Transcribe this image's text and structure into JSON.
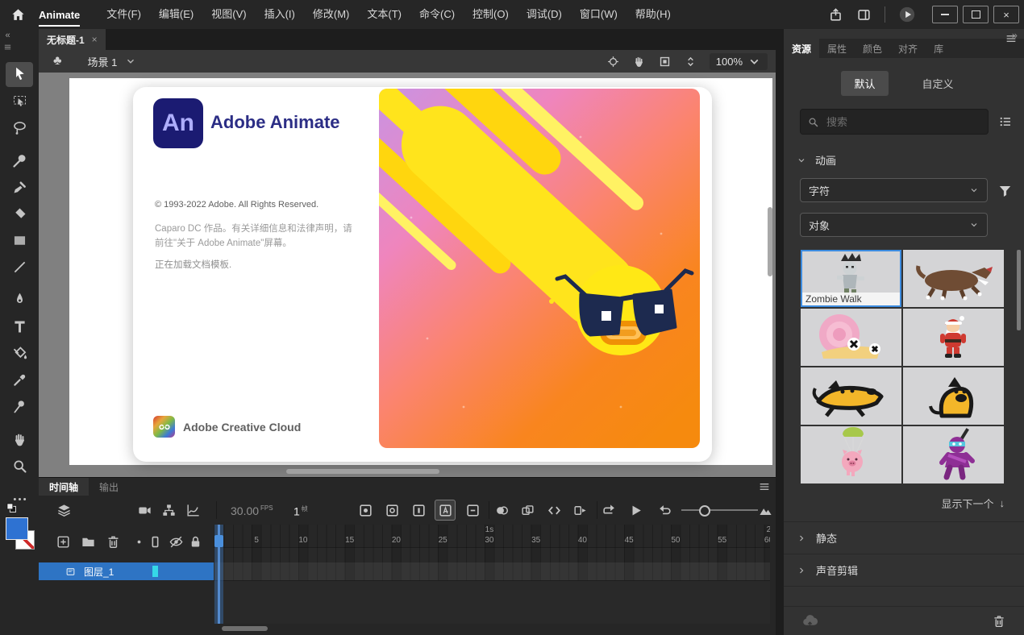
{
  "glyphs": {
    "collapse_left": "«",
    "collapse_right": "»",
    "down_arrow": "↓",
    "close": "×",
    "scene": "♣"
  },
  "menubar": {
    "app_label": "Animate",
    "items": [
      {
        "label": "文件(F)"
      },
      {
        "label": "编辑(E)"
      },
      {
        "label": "视图(V)"
      },
      {
        "label": "插入(I)"
      },
      {
        "label": "修改(M)"
      },
      {
        "label": "文本(T)"
      },
      {
        "label": "命令(C)"
      },
      {
        "label": "控制(O)"
      },
      {
        "label": "调试(D)"
      },
      {
        "label": "窗口(W)"
      },
      {
        "label": "帮助(H)"
      }
    ]
  },
  "document_tab": {
    "title": "无标题-1"
  },
  "edit_bar": {
    "scene_label": "场景 1",
    "zoom_value": "100%"
  },
  "tools": [
    {
      "name": "selection-tool",
      "icon": "pointer",
      "active": true
    },
    {
      "name": "free-transform-tool",
      "icon": "transform"
    },
    {
      "name": "lasso-tool",
      "icon": "lasso"
    },
    {
      "name": "fluid-brush-tool",
      "icon": "fluidbrush",
      "gap": true
    },
    {
      "name": "classic-brush-tool",
      "icon": "brush"
    },
    {
      "name": "eraser-tool",
      "icon": "eraser"
    },
    {
      "name": "rectangle-tool",
      "icon": "rect"
    },
    {
      "name": "line-tool",
      "icon": "line"
    },
    {
      "name": "pen-tool",
      "icon": "pen",
      "gap": true
    },
    {
      "name": "text-tool",
      "icon": "text"
    },
    {
      "name": "paint-bucket-tool",
      "icon": "bucket"
    },
    {
      "name": "eyedropper-tool",
      "icon": "eyedropper"
    },
    {
      "name": "asset-warp-tool",
      "icon": "pin"
    },
    {
      "name": "hand-tool",
      "icon": "hand",
      "gap": true
    },
    {
      "name": "zoom-tool",
      "icon": "magnifier"
    },
    {
      "name": "more-tools",
      "icon": "ellipsis",
      "gap": true
    }
  ],
  "splash": {
    "logo_text": "An",
    "title": "Adobe Animate",
    "copyright": "© 1993-2022 Adobe. All Rights Reserved.",
    "credit_line1": "Caparo DC 作品。有关详细信息和法律声明，请",
    "credit_line2": "前往\"关于 Adobe Animate\"屏幕。",
    "loading_status": "正在加载文档模板.",
    "cc_label": "Adobe Creative Cloud"
  },
  "timeline": {
    "tabs": [
      {
        "label": "时间轴",
        "active": true
      },
      {
        "label": "输出"
      }
    ],
    "fps": {
      "value": "30.00",
      "unit": "FPS"
    },
    "current_frame": {
      "value": "1",
      "unit": "帧"
    },
    "layers": [
      {
        "name": "图层_1",
        "selected": true
      }
    ],
    "ruler": [
      {
        "n": 5
      },
      {
        "n": 10
      },
      {
        "n": 15
      },
      {
        "n": 20
      },
      {
        "n": 25
      },
      {
        "n": 30
      },
      {
        "n": 35
      },
      {
        "n": 40
      },
      {
        "n": 45
      },
      {
        "n": 50
      },
      {
        "n": 55
      },
      {
        "n": 60
      }
    ],
    "seconds": [
      {
        "label": "1s",
        "frame": 30
      },
      {
        "label": "2",
        "frame": 60
      }
    ]
  },
  "assets": {
    "panel_tabs": [
      {
        "label": "资源",
        "active": true
      },
      {
        "label": "属性"
      },
      {
        "label": "颜色"
      },
      {
        "label": "对齐"
      },
      {
        "label": "库"
      }
    ],
    "mode_tabs": [
      {
        "label": "默认",
        "active": true
      },
      {
        "label": "自定义"
      }
    ],
    "search_placeholder": "搜索",
    "section_animation": "动画",
    "section_static": "静态",
    "section_sound": "声音剪辑",
    "filters": [
      {
        "value": "字符"
      },
      {
        "value": "对象"
      }
    ],
    "items": [
      {
        "kind": "zombie",
        "label": "Zombie Walk",
        "selected": true
      },
      {
        "kind": "wolf",
        "label": ""
      },
      {
        "kind": "snail",
        "label": ""
      },
      {
        "kind": "santa",
        "label": ""
      },
      {
        "kind": "dogrun",
        "label": ""
      },
      {
        "kind": "dogsit",
        "label": ""
      },
      {
        "kind": "pig",
        "label": ""
      },
      {
        "kind": "ninja",
        "label": ""
      }
    ],
    "show_next_label": "显示下一个"
  },
  "colors": {
    "accent_blue": "#3d8ce0",
    "layer_selection_blue": "#2e74c4",
    "fill_swatch_blue": "#2e72d2",
    "animate_logo_bg": "#1b1b72",
    "animate_logo_text": "#aeaefc",
    "splash_title": "#2b2d85"
  }
}
